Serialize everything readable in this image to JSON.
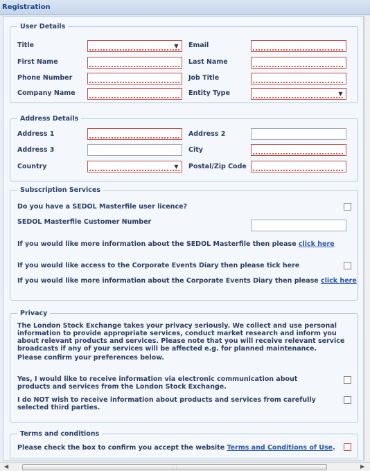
{
  "window": {
    "title": "Registration"
  },
  "user_details": {
    "legend": "User Details",
    "title_label": "Title",
    "email_label": "Email",
    "first_name_label": "First Name",
    "last_name_label": "Last Name",
    "phone_label": "Phone Number",
    "job_title_label": "Job Title",
    "company_label": "Company Name",
    "entity_type_label": "Entity Type"
  },
  "address_details": {
    "legend": "Address Details",
    "address1_label": "Address 1",
    "address2_label": "Address 2",
    "address3_label": "Address 3",
    "city_label": "City",
    "country_label": "Country",
    "postal_label": "Postal/Zip Code"
  },
  "subscription": {
    "legend": "Subscription Services",
    "licence_question": "Do you have a SEDOL Masterfile user licence?",
    "customer_number_label": "SEDOL Masterfile Customer Number",
    "masterfile_info_text": "If you would like more information about the SEDOL Masterfile then please",
    "masterfile_link": "click here",
    "diary_access_text": "If you would like access to the Corporate Events Diary then please tick here",
    "diary_info_text": "If you would like more information about the Corporate Events Diary then please",
    "diary_link": "click here"
  },
  "privacy": {
    "legend": "Privacy",
    "statement": "The London Stock Exchange takes your privacy seriously. We collect and use personal information to provide appropriate services, conduct market research and inform you about relevant products and services. Please note that you will receive relevant service broadcasts if any of your services will be affected e.g. for planned maintenance.",
    "confirm_text": "Please confirm your preferences below.",
    "optin_text": "Yes, I would like to receive information via electronic communication about products and services from the London Stock Exchange.",
    "optout_text": "I do NOT wish to receive information about products and services from carefully selected third parties."
  },
  "terms": {
    "legend": "Terms and conditions",
    "text": "Please check the box to confirm you accept the website",
    "link": "Terms and Conditions of Use",
    "suffix": "."
  },
  "icons": {
    "dropdown": "chevron-down-icon",
    "scroll_left": "arrow-left-icon",
    "scroll_right": "arrow-right-icon"
  },
  "colors": {
    "required_border": "#c0504d",
    "link": "#2b55a8",
    "legend": "#2a3f6b",
    "titlebar": "#15428b"
  }
}
